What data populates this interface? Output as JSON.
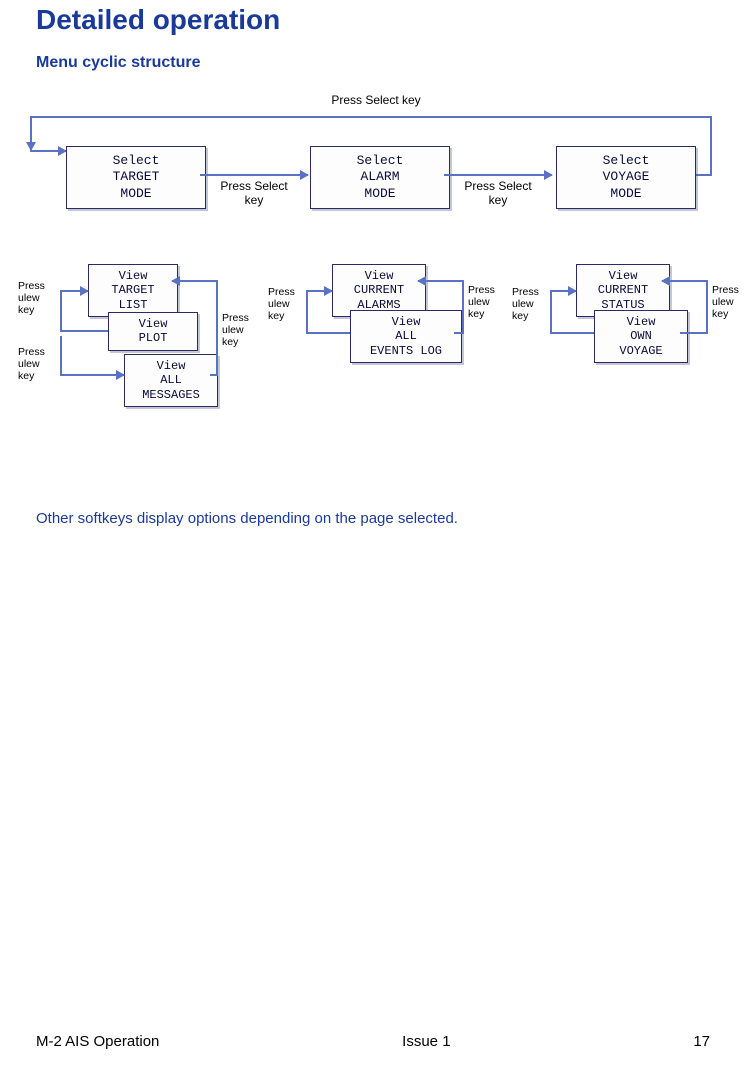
{
  "headings": {
    "main": "Detailed operation",
    "sub": "Menu cyclic structure"
  },
  "topLabel": "Press Select key",
  "mainBoxes": {
    "target": {
      "l1": "Select",
      "l2": "TARGET",
      "l3": "MODE"
    },
    "alarm": {
      "l1": "Select",
      "l2": "ALARM",
      "l3": "MODE"
    },
    "voyage": {
      "l1": "Select",
      "l2": "VOYAGE",
      "l3": "MODE"
    }
  },
  "arrowLabels": {
    "between12": "Press Select\nkey",
    "between23": "Press Select\nkey"
  },
  "groups": {
    "g1": {
      "b1": {
        "l1": "View",
        "l2": "TARGET",
        "l3": "LIST"
      },
      "b2": {
        "l1": "View",
        "l2": "PLOT"
      },
      "b3": {
        "l1": "View",
        "l2": "ALL",
        "l3": "MESSAGES"
      },
      "lblTL": "Press\nulew\nkey",
      "lblBL": "Press\nulew\nkey",
      "lblR": "Press\nulew\nkey"
    },
    "g2": {
      "b1": {
        "l1": "View",
        "l2": "CURRENT",
        "l3": "ALARMS"
      },
      "b2": {
        "l1": "View",
        "l2": "ALL",
        "l3": "EVENTS LOG"
      },
      "lblL": "Press\nulew\nkey",
      "lblR": "Press\nulew\nkey"
    },
    "g3": {
      "b1": {
        "l1": "View",
        "l2": "CURRENT",
        "l3": "STATUS"
      },
      "b2": {
        "l1": "View",
        "l2": "OWN",
        "l3": "VOYAGE"
      },
      "lblL": "Press\nulew\nkey",
      "lblR": "Press\nulew\nkey"
    }
  },
  "note": "Other softkeys display options depending on the page selected.",
  "footer": {
    "left": "M-2 AIS Operation",
    "center": "Issue 1",
    "right": "17"
  }
}
